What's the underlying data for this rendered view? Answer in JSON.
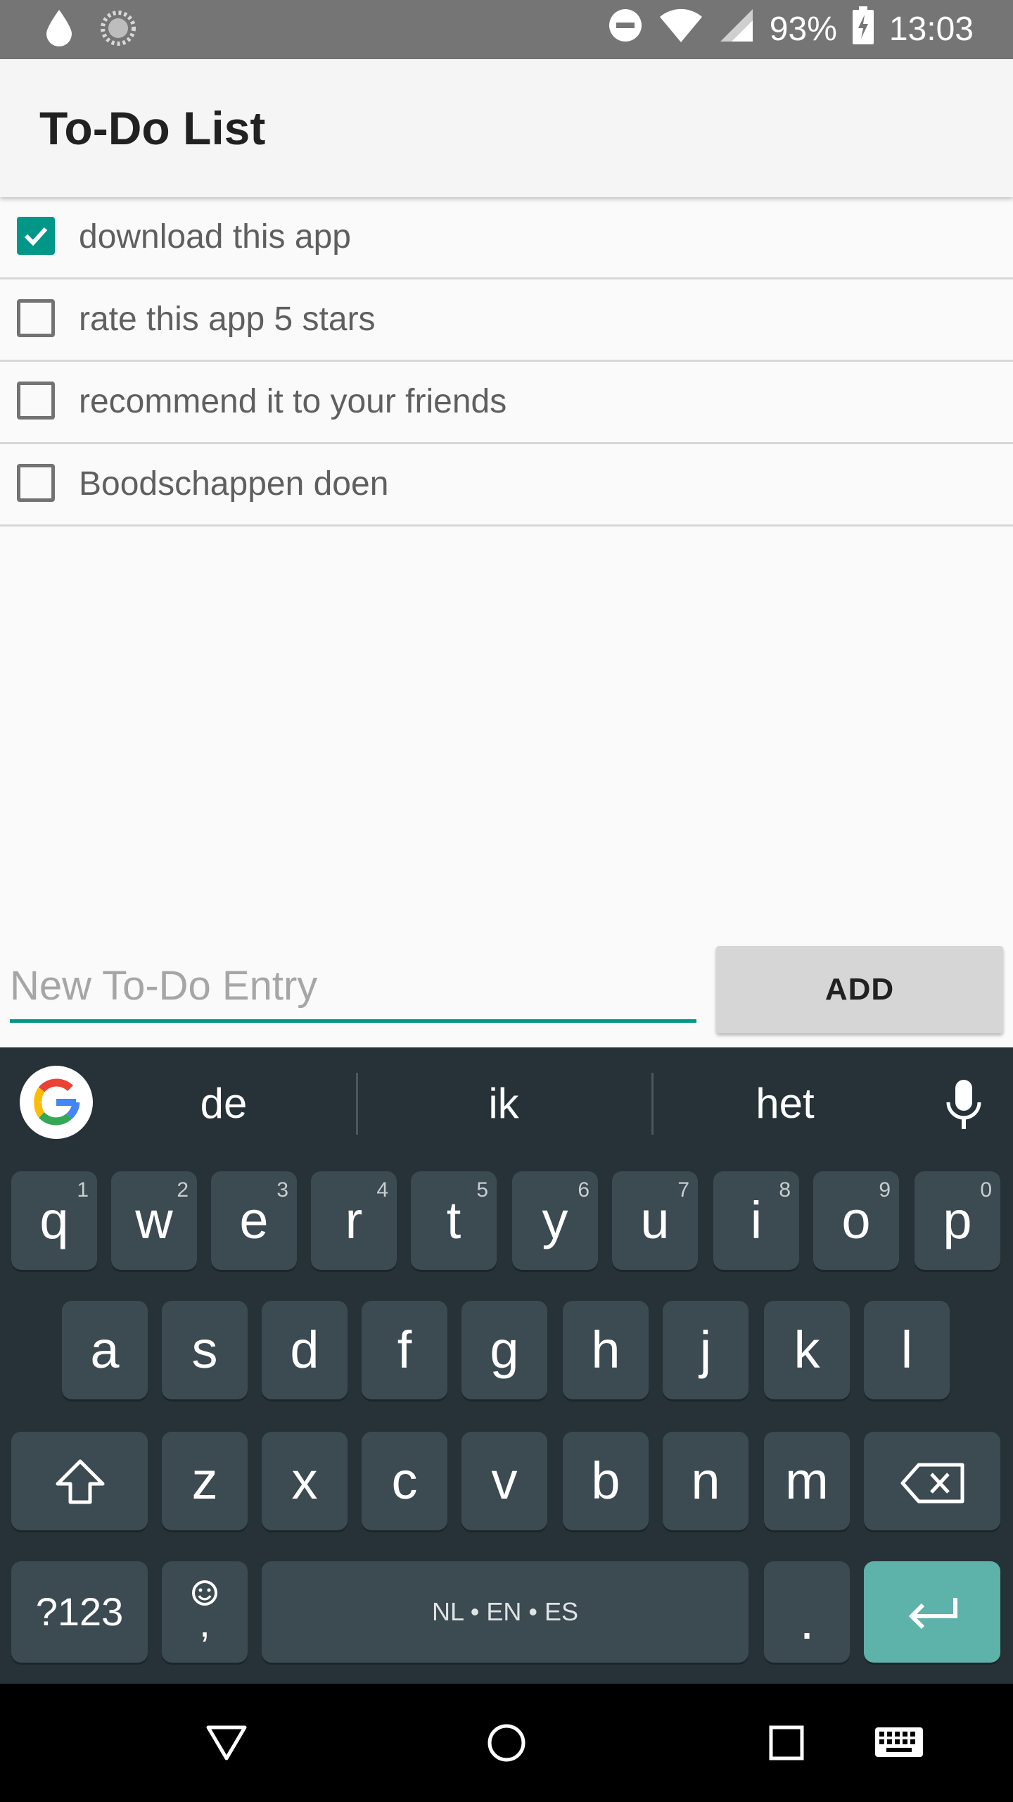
{
  "status_bar": {
    "battery": "93%",
    "time": "13:03",
    "icons": [
      "drop-icon",
      "sync-icon",
      "dnd-icon",
      "wifi-icon",
      "signal-icon",
      "battery-charging-icon"
    ]
  },
  "app_bar": {
    "title": "To-Do List"
  },
  "todos": [
    {
      "label": "download this app",
      "checked": true
    },
    {
      "label": "rate this app 5 stars",
      "checked": false
    },
    {
      "label": "recommend it to your friends",
      "checked": false
    },
    {
      "label": "Boodschappen doen",
      "checked": false
    }
  ],
  "entry": {
    "placeholder": "New To-Do Entry",
    "value": ""
  },
  "add_button": {
    "label": "ADD"
  },
  "keyboard": {
    "suggestions": [
      "de",
      "ik",
      "het"
    ],
    "row1": [
      {
        "k": "q",
        "h": "1"
      },
      {
        "k": "w",
        "h": "2"
      },
      {
        "k": "e",
        "h": "3"
      },
      {
        "k": "r",
        "h": "4"
      },
      {
        "k": "t",
        "h": "5"
      },
      {
        "k": "y",
        "h": "6"
      },
      {
        "k": "u",
        "h": "7"
      },
      {
        "k": "i",
        "h": "8"
      },
      {
        "k": "o",
        "h": "9"
      },
      {
        "k": "p",
        "h": "0"
      }
    ],
    "row2": [
      "a",
      "s",
      "d",
      "f",
      "g",
      "h",
      "j",
      "k",
      "l"
    ],
    "row3": [
      "z",
      "x",
      "c",
      "v",
      "b",
      "n",
      "m"
    ],
    "symbols_key": "?123",
    "comma_key": ",",
    "space_label": "NL • EN • ES",
    "period_key": "."
  },
  "nav_bar": {
    "icons": [
      "back-icon",
      "home-icon",
      "recents-icon",
      "keyboard-icon"
    ]
  },
  "colors": {
    "accent": "#009688",
    "keyboard_bg": "#263238",
    "key_bg": "#3c4a52",
    "enter_key": "#5db2a9"
  }
}
